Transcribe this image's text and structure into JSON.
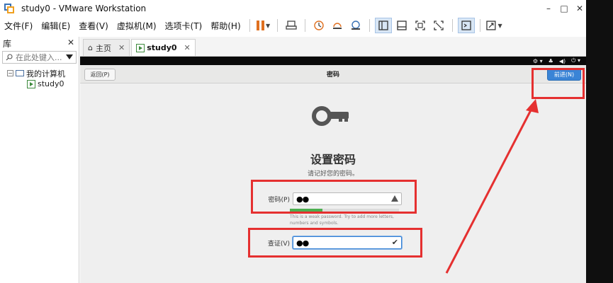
{
  "window": {
    "title": "study0 - VMware Workstation",
    "controls": {
      "minimize": "–",
      "maximize": "□",
      "close": "✕"
    }
  },
  "menu": {
    "items": [
      "文件(F)",
      "编辑(E)",
      "查看(V)",
      "虚拟机(M)",
      "选项卡(T)",
      "帮助(H)"
    ]
  },
  "toolbar": {
    "icons": [
      "pause-icon",
      "send-keys-icon",
      "snapshot-icon",
      "revert-snapshot-icon",
      "snapshot-manager-icon",
      "library-view-icon",
      "thumbnail-view-icon",
      "fullscreen-icon",
      "unity-icon",
      "console-icon",
      "stretch-icon"
    ]
  },
  "library": {
    "title": "库",
    "close": "✕",
    "search_placeholder": "在此处键入...",
    "tree": {
      "root": "我的计算机",
      "root_expander": "⊟",
      "children": [
        "study0"
      ]
    }
  },
  "tabs": [
    {
      "label": "主页",
      "close": "✕"
    },
    {
      "label": "study0",
      "close": "✕"
    }
  ],
  "guest": {
    "header": {
      "back_label": "返回(P)",
      "title": "密码",
      "next_label": "前进(N)"
    },
    "heading": "设置密码",
    "subheading": "请记好您的密码。",
    "password": {
      "label": "密码(P)",
      "value": "●●",
      "strength": 0.3,
      "hint": "This is a weak password. Try to add more letters, numbers and symbols."
    },
    "confirm": {
      "label": "查证(V)",
      "value": "●●",
      "check": "✔"
    }
  },
  "colors": {
    "annotation": "#e53030",
    "accent": "#3a84d6",
    "strength_fill": "#4caf50"
  }
}
